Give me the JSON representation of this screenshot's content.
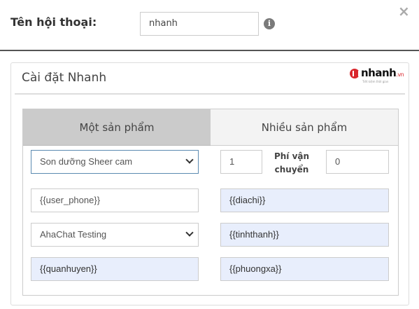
{
  "header": {
    "conversation_label": "Tên hội thoại:",
    "conversation_value": "nhanh"
  },
  "panel": {
    "title": "Cài đặt Nhanh",
    "logo": {
      "word": "nhanh",
      "tld": ".vn",
      "tagline": "Tiết kiệm thời gian",
      "brand_color": "#d9262c"
    }
  },
  "tabs": {
    "single_product": "Một sản phẩm",
    "multiple_products": "Nhiều sản phẩm",
    "active": "single_product"
  },
  "form": {
    "product_select": "Son dưỡng Sheer cam",
    "quantity": "1",
    "shipping_label": "Phí vận chuyển",
    "shipping_fee": "0",
    "phone": "{{user_phone}}",
    "address": "{{diachi}}",
    "chat_select": "AhaChat Testing",
    "province": "{{tinhthanh}}",
    "district": "{{quanhuyen}}",
    "ward": "{{phuongxa}}"
  },
  "colors": {
    "variable_bg": "#e8eefc",
    "active_tab_bg": "#cbcbcb",
    "inactive_tab_bg": "#f3f3f3",
    "focus_border": "#5b8ab1"
  }
}
